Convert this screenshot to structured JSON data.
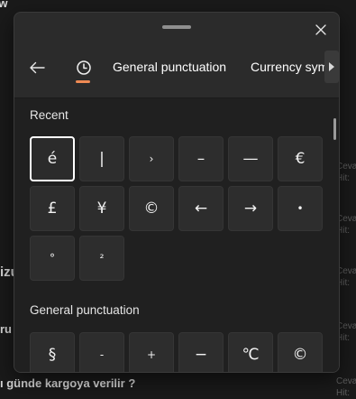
{
  "background": {
    "fragment_top": "tw",
    "fragment_mid": "izu",
    "fragment_mid2": "ru",
    "fragment_bottom": "ı günde kargoya verilir ?",
    "meta_rows": [
      {
        "a": "Cevap",
        "b": "Hit:"
      },
      {
        "a": "Cevap",
        "b": "Hit:"
      },
      {
        "a": "Cevap",
        "b": "Hit:"
      },
      {
        "a": "Cevap",
        "b": "Hit:"
      },
      {
        "a": "Cevap",
        "b": "Hit:"
      }
    ],
    "meta_bottom": "Ceva"
  },
  "panel": {
    "tabs": [
      "General punctuation",
      "Currency symbo"
    ],
    "sections": {
      "recent": {
        "title": "Recent",
        "symbols": [
          "é",
          "|",
          "›",
          "–",
          "—",
          "€",
          "£",
          "¥",
          "©",
          "←",
          "→",
          "•",
          "°",
          "²"
        ]
      },
      "general_punctuation": {
        "title": "General punctuation",
        "symbols": [
          "§",
          "-",
          "+",
          "−",
          "℃",
          "©"
        ]
      }
    },
    "icons": {
      "close": "close-icon",
      "back": "back-arrow-icon",
      "recent": "clock-icon",
      "scroll": "chevron-right-icon"
    },
    "accent_color": "#ef8a54"
  }
}
